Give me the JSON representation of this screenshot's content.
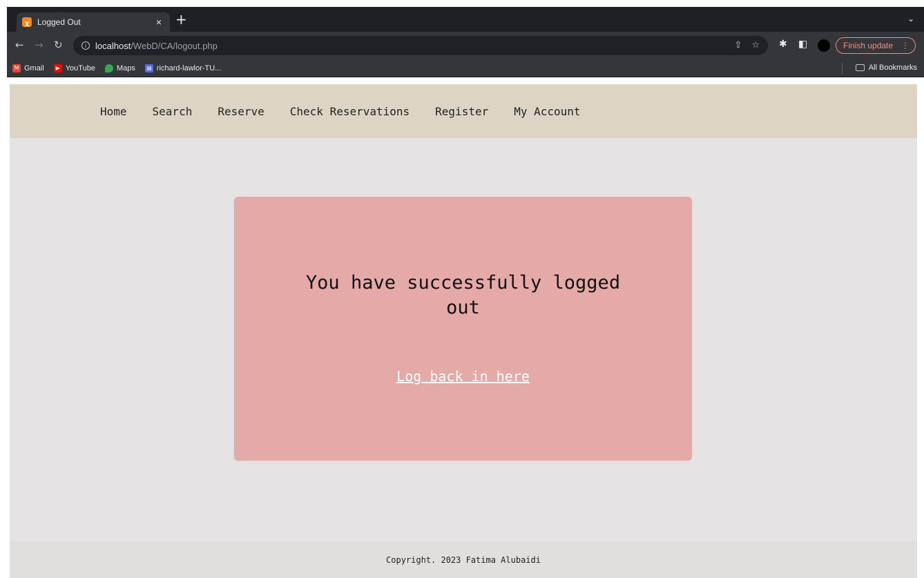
{
  "browser": {
    "tab_title": "Logged Out",
    "url_host": "localhost",
    "url_path": "/WebD/CA/logout.php",
    "update_label": "Finish update",
    "bookmarks": [
      "Gmail",
      "YouTube",
      "Maps",
      "richard-lawlor-TU..."
    ],
    "all_bookmarks": "All Bookmarks"
  },
  "nav": {
    "items": [
      "Home",
      "Search",
      "Reserve",
      "Check Reservations",
      "Register",
      "My Account"
    ]
  },
  "card": {
    "message": "You have successfully logged out",
    "link": "Log back in here",
    "color": "#e5a9a8"
  },
  "footer": {
    "text": "Copyright. 2023 Fatima Alubaidi"
  }
}
